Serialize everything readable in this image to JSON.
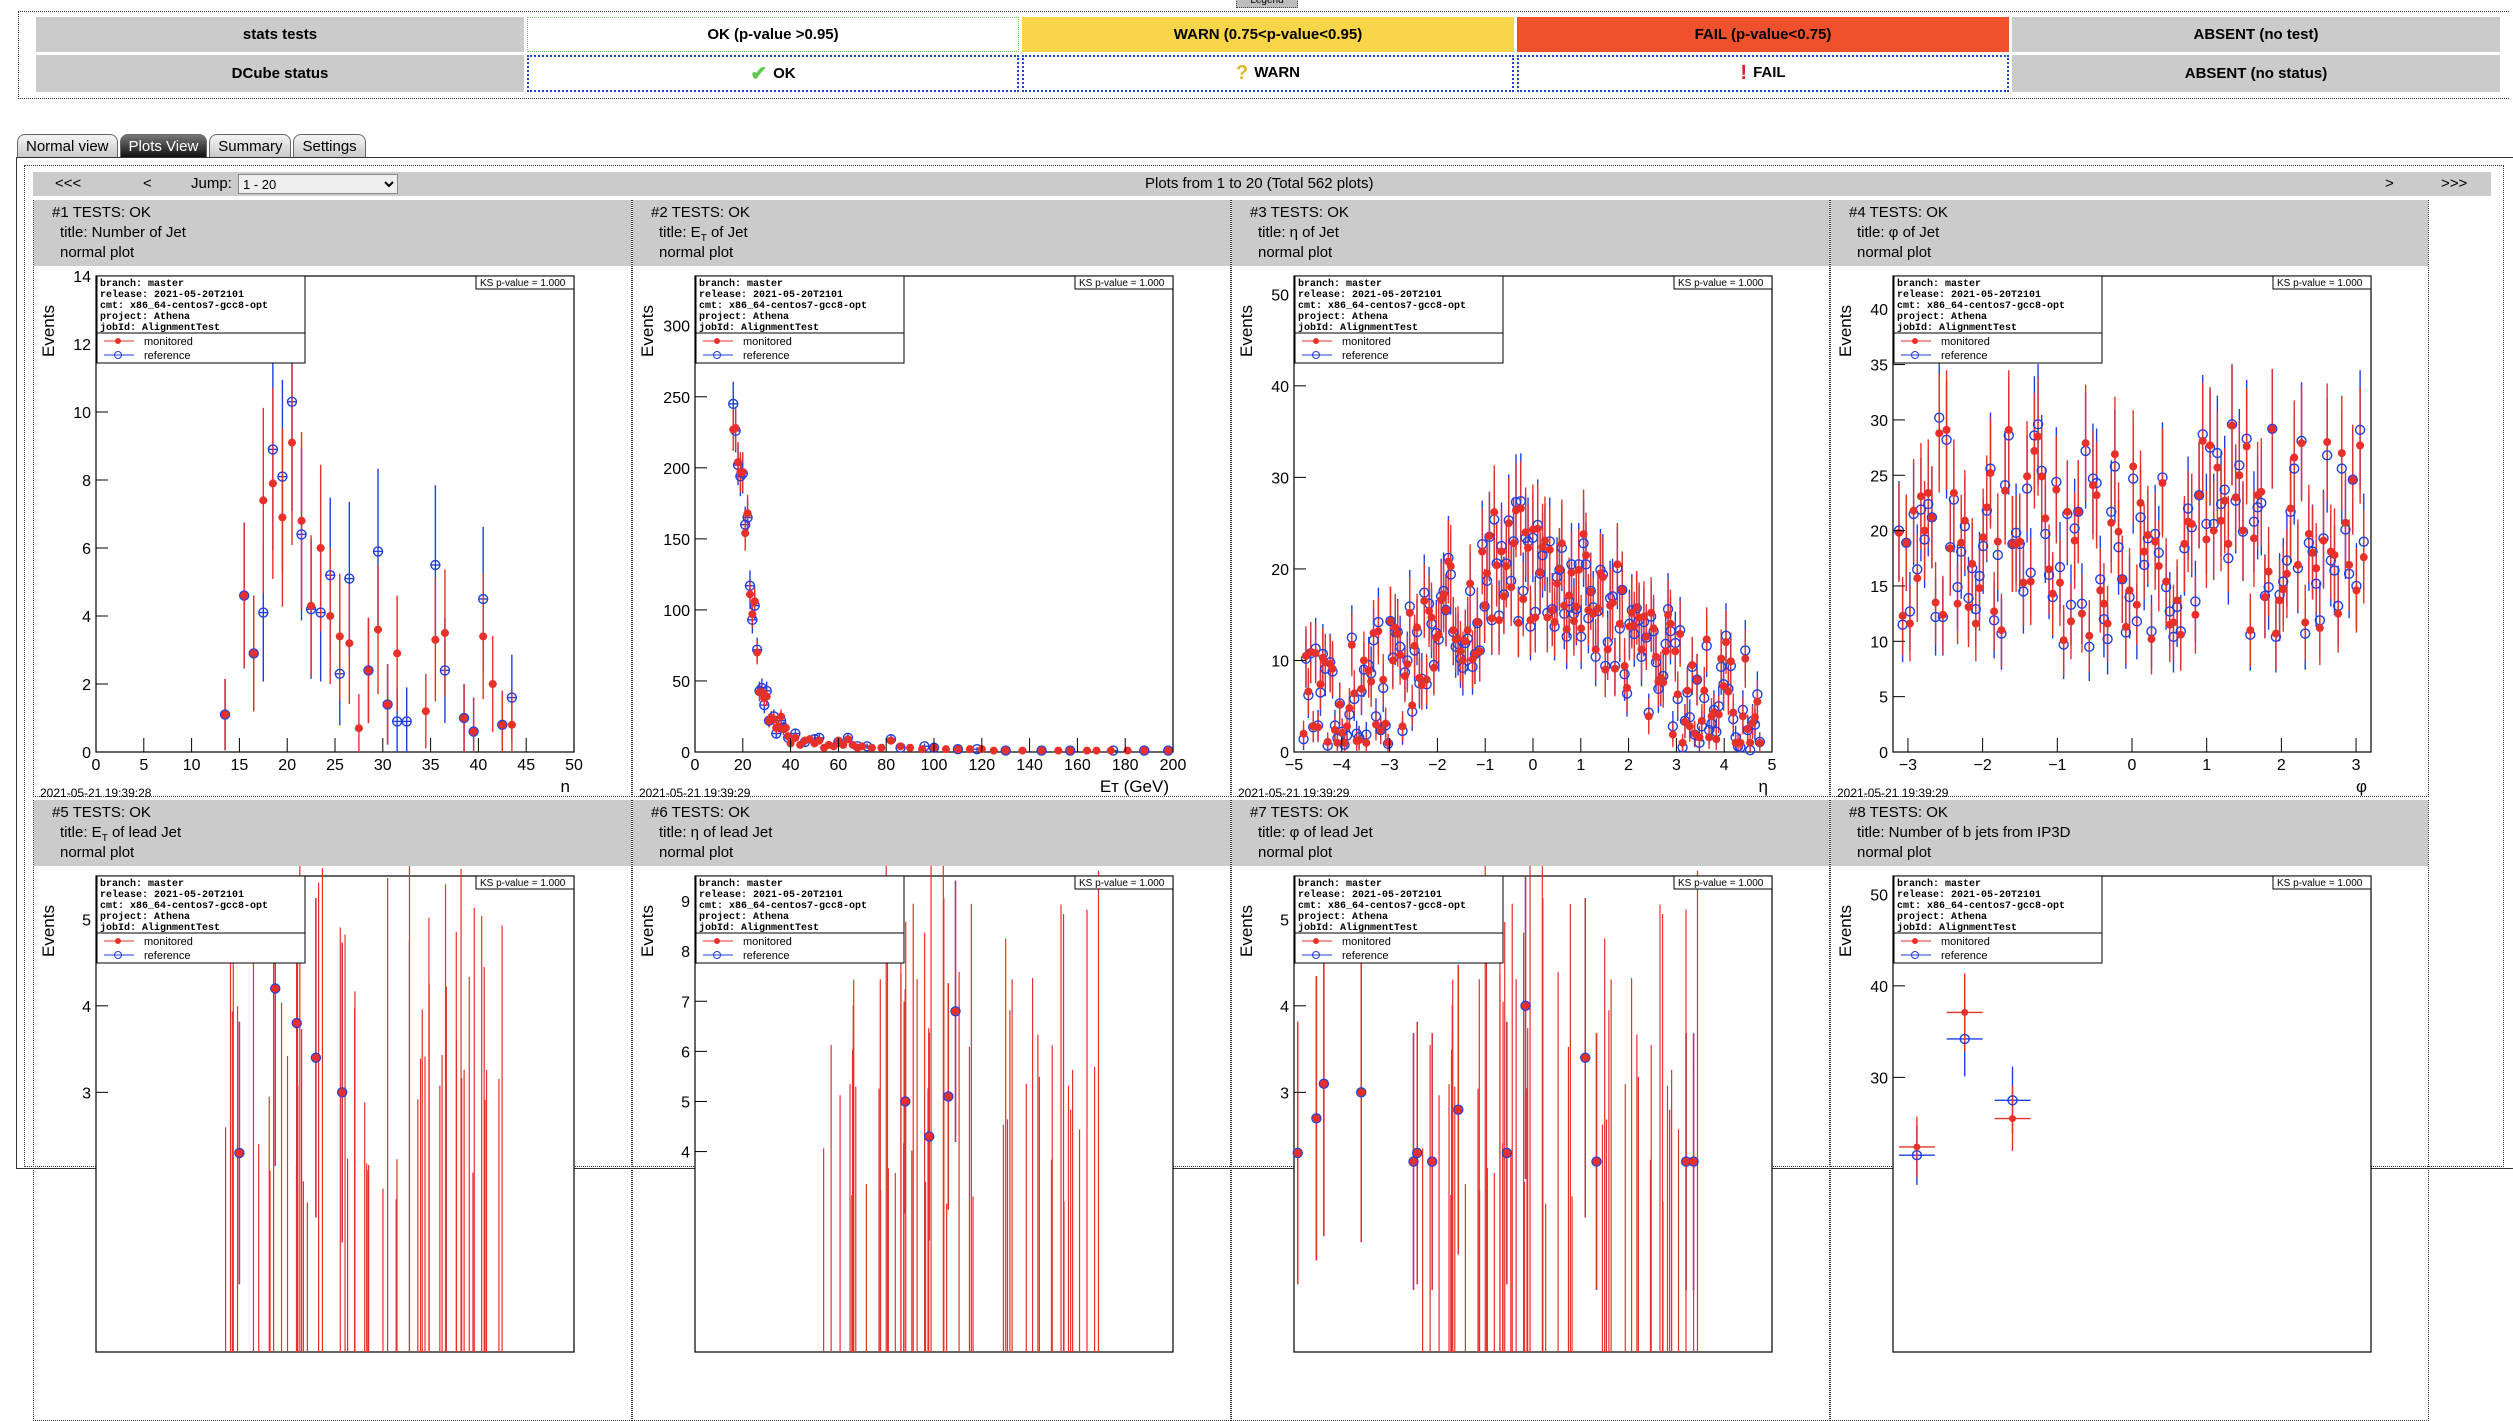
{
  "legend_button": "Legend",
  "legend": {
    "rows": [
      {
        "label": "stats tests",
        "cells": [
          {
            "text": "OK (p-value >0.95)",
            "kind": "ok"
          },
          {
            "text": "WARN (0.75<p-value<0.95)",
            "kind": "warn"
          },
          {
            "text": "FAIL (p-value<0.75)",
            "kind": "fail"
          },
          {
            "text": "ABSENT (no test)",
            "kind": "abs"
          }
        ]
      },
      {
        "label": "DCube status",
        "cells": [
          {
            "text": "OK",
            "kind": "st",
            "icon": "check-icon",
            "glyph": "✔",
            "color": "#5cc94a"
          },
          {
            "text": "WARN",
            "kind": "st",
            "icon": "question-icon",
            "glyph": "?",
            "color": "#e0b62a"
          },
          {
            "text": "FAIL",
            "kind": "st",
            "icon": "exclamation-icon",
            "glyph": "!",
            "color": "#e02020"
          },
          {
            "text": "ABSENT (no status)",
            "kind": "abs"
          }
        ]
      }
    ],
    "colors": {
      "ok_border": "#6ad36a",
      "warn": "#f9d54a",
      "fail": "#ee512b",
      "absent": "#cbcbcb"
    }
  },
  "tabs": [
    {
      "label": "Normal view",
      "active": false
    },
    {
      "label": "Plots View",
      "active": true
    },
    {
      "label": "Summary",
      "active": false
    },
    {
      "label": "Settings",
      "active": false
    }
  ],
  "nav": {
    "first": "<<<",
    "prev": "<",
    "jump_label": "Jump:",
    "jump_value": "1 - 20",
    "range_text": "Plots from 1 to 20 (Total 562 plots)",
    "next": ">",
    "last": ">>>"
  },
  "plot_common": {
    "info": [
      [
        "branch:",
        "master"
      ],
      [
        "release:",
        "2021-05-20T2101"
      ],
      [
        "cmt:",
        "x86_64-centos7-gcc8-opt"
      ],
      [
        "project:",
        "Athena"
      ],
      [
        "jobId:",
        "AlignmentTest"
      ]
    ],
    "legend_monitored": "monitored",
    "legend_reference": "reference",
    "ks_text": "KS   p-value = 1.000",
    "ylabel": "Events",
    "monitored_color": "#e8302a",
    "reference_color": "#1f3fe0"
  },
  "plots": [
    {
      "header": "#1 TESTS: OK",
      "title": "title: Number of Jet",
      "kind": "normal plot",
      "timestamp": "2021-05-21 19:39:28",
      "chart_data": {
        "type": "scatter",
        "xlabel": "n",
        "xlim": [
          0,
          50
        ],
        "ylim": [
          0,
          14
        ],
        "xticks": [
          0,
          5,
          10,
          15,
          20,
          25,
          30,
          35,
          40,
          45,
          50
        ],
        "yticks": [
          0,
          2,
          4,
          6,
          8,
          10,
          12,
          14
        ],
        "monitored": [
          [
            13.5,
            1.1
          ],
          [
            15.5,
            4.6
          ],
          [
            16.5,
            2.9
          ],
          [
            17.5,
            7.4
          ],
          [
            18.5,
            7.9
          ],
          [
            19.5,
            6.9
          ],
          [
            20.5,
            9.1
          ],
          [
            21.5,
            6.8
          ],
          [
            22.5,
            4.3
          ],
          [
            23.5,
            6.0
          ],
          [
            24.5,
            4.0
          ],
          [
            25.5,
            3.4
          ],
          [
            26.5,
            3.2
          ],
          [
            27.5,
            0.7
          ],
          [
            28.5,
            2.4
          ],
          [
            29.5,
            3.6
          ],
          [
            30.5,
            1.4
          ],
          [
            31.5,
            2.9
          ],
          [
            34.5,
            1.2
          ],
          [
            35.5,
            3.3
          ],
          [
            36.5,
            3.5
          ],
          [
            38.5,
            1.0
          ],
          [
            39.5,
            0.6
          ],
          [
            40.5,
            3.4
          ],
          [
            41.5,
            2.0
          ],
          [
            42.5,
            0.8
          ],
          [
            43.5,
            0.8
          ]
        ],
        "reference": [
          [
            13.5,
            1.1
          ],
          [
            15.5,
            4.6
          ],
          [
            16.5,
            2.9
          ],
          [
            17.5,
            4.1
          ],
          [
            18.5,
            8.9
          ],
          [
            19.5,
            8.1
          ],
          [
            20.5,
            10.3
          ],
          [
            21.5,
            6.4
          ],
          [
            22.5,
            4.2
          ],
          [
            23.5,
            4.1
          ],
          [
            24.5,
            5.2
          ],
          [
            25.5,
            2.3
          ],
          [
            26.5,
            5.1
          ],
          [
            28.5,
            2.4
          ],
          [
            29.5,
            5.9
          ],
          [
            30.5,
            1.4
          ],
          [
            31.5,
            0.9
          ],
          [
            32.5,
            0.9
          ],
          [
            35.5,
            5.5
          ],
          [
            36.5,
            2.4
          ],
          [
            38.5,
            1.0
          ],
          [
            39.5,
            0.6
          ],
          [
            40.5,
            4.5
          ],
          [
            42.5,
            0.8
          ],
          [
            43.5,
            1.6
          ]
        ]
      }
    },
    {
      "header": "#2 TESTS: OK",
      "title": "title: E_T of Jet",
      "kind": "normal plot",
      "timestamp": "2021-05-21 19:39:29",
      "chart_data": {
        "type": "scatter",
        "xlabel": "E_T (GeV)",
        "xlim": [
          0,
          200
        ],
        "ylim": [
          0,
          335
        ],
        "xticks": [
          0,
          20,
          40,
          60,
          80,
          100,
          120,
          140,
          160,
          180,
          200
        ],
        "yticks": [
          0,
          50,
          100,
          150,
          200,
          250,
          300
        ],
        "monitored": [
          [
            16,
            227
          ],
          [
            17,
            228
          ],
          [
            18,
            204
          ],
          [
            19,
            197
          ],
          [
            20,
            197
          ],
          [
            21,
            154
          ],
          [
            22,
            168
          ],
          [
            23,
            111
          ],
          [
            24,
            97
          ],
          [
            25,
            106
          ],
          [
            26,
            70
          ],
          [
            27,
            42
          ],
          [
            28,
            42
          ],
          [
            29,
            38
          ],
          [
            30,
            39
          ],
          [
            31,
            22
          ],
          [
            32,
            24
          ],
          [
            33,
            23
          ],
          [
            34,
            17
          ],
          [
            35,
            18
          ],
          [
            36,
            25
          ],
          [
            37,
            16
          ],
          [
            38,
            17
          ],
          [
            39,
            11
          ],
          [
            40,
            6
          ],
          [
            42,
            10
          ],
          [
            44,
            5
          ],
          [
            46,
            8
          ],
          [
            48,
            9
          ],
          [
            50,
            6
          ],
          [
            52,
            8
          ],
          [
            54,
            3
          ],
          [
            56,
            5
          ],
          [
            58,
            4
          ],
          [
            60,
            8
          ],
          [
            62,
            5
          ],
          [
            64,
            9
          ],
          [
            66,
            5
          ],
          [
            68,
            3
          ],
          [
            70,
            4
          ],
          [
            74,
            3
          ],
          [
            78,
            3
          ],
          [
            82,
            8
          ],
          [
            86,
            4
          ],
          [
            90,
            3
          ],
          [
            95,
            2
          ],
          [
            100,
            3
          ],
          [
            105,
            2
          ],
          [
            110,
            2
          ],
          [
            115,
            2
          ],
          [
            120,
            2
          ],
          [
            125,
            1
          ],
          [
            130,
            1
          ],
          [
            137,
            1
          ],
          [
            145,
            1
          ],
          [
            152,
            1
          ],
          [
            157,
            1
          ],
          [
            164,
            1
          ],
          [
            168,
            1
          ],
          [
            174,
            1
          ],
          [
            181,
            1
          ],
          [
            188,
            1
          ],
          [
            198,
            1
          ]
        ],
        "reference": [
          [
            16,
            245
          ],
          [
            17,
            226
          ],
          [
            18,
            202
          ],
          [
            19,
            194
          ],
          [
            20,
            196
          ],
          [
            21,
            160
          ],
          [
            22,
            165
          ],
          [
            23,
            117
          ],
          [
            24,
            93
          ],
          [
            25,
            103
          ],
          [
            26,
            72
          ],
          [
            27,
            43
          ],
          [
            28,
            45
          ],
          [
            29,
            33
          ],
          [
            30,
            43
          ],
          [
            31,
            22
          ],
          [
            33,
            25
          ],
          [
            34,
            13
          ],
          [
            36,
            22
          ],
          [
            37,
            17
          ],
          [
            39,
            10
          ],
          [
            42,
            13
          ],
          [
            46,
            7
          ],
          [
            50,
            9
          ],
          [
            52,
            10
          ],
          [
            60,
            7
          ],
          [
            64,
            10
          ],
          [
            68,
            4
          ],
          [
            72,
            4
          ],
          [
            82,
            9
          ],
          [
            86,
            3
          ],
          [
            96,
            4
          ],
          [
            100,
            3
          ],
          [
            110,
            2
          ],
          [
            118,
            2
          ],
          [
            130,
            1
          ],
          [
            145,
            1
          ],
          [
            157,
            1
          ],
          [
            175,
            1
          ],
          [
            188,
            1
          ],
          [
            198,
            1
          ]
        ]
      }
    },
    {
      "header": "#3 TESTS: OK",
      "title": "title: η of Jet",
      "kind": "normal plot",
      "timestamp": "2021-05-21 19:39:29",
      "chart_data": {
        "type": "scatter",
        "xlabel": "η",
        "xlim": [
          -5,
          5
        ],
        "ylim": [
          0,
          52
        ],
        "xticks": [
          -5,
          -4,
          -3,
          -2,
          -1,
          0,
          1,
          2,
          3,
          4,
          5
        ],
        "yticks": [
          0,
          10,
          20,
          30,
          40,
          50
        ],
        "generator": "eta",
        "seed": 3
      }
    },
    {
      "header": "#4 TESTS: OK",
      "title": "title: φ of Jet",
      "kind": "normal plot",
      "timestamp": "2021-05-21 19:39:29",
      "chart_data": {
        "type": "scatter",
        "xlabel": "φ",
        "xlim": [
          -3.2,
          3.2
        ],
        "ylim": [
          0,
          43
        ],
        "xticks": [
          -3,
          -2,
          -1,
          0,
          1,
          2,
          3
        ],
        "yticks": [
          0,
          5,
          10,
          15,
          20,
          25,
          30,
          35,
          40
        ],
        "generator": "phi",
        "seed": 7
      }
    },
    {
      "header": "#5 TESTS: OK",
      "title": "title: E_T of lead Jet",
      "kind": "normal plot",
      "timestamp": "",
      "chart_data": {
        "type": "scatter",
        "xlabel": "",
        "xlim": [
          0,
          200
        ],
        "ylim": [
          0,
          5.5
        ],
        "yticks": [
          3,
          4,
          5
        ],
        "monitored": [
          [
            60,
            2.3
          ],
          [
            75,
            4.2
          ],
          [
            84,
            3.8
          ],
          [
            92,
            3.4
          ],
          [
            103,
            3.0
          ]
        ],
        "reference": [
          [
            60,
            2.3
          ],
          [
            75,
            4.2
          ],
          [
            84,
            3.8
          ],
          [
            92,
            3.4
          ],
          [
            103,
            3.0
          ]
        ],
        "spikes": "lead_et"
      }
    },
    {
      "header": "#6 TESTS: OK",
      "title": "title: η of lead Jet",
      "kind": "normal plot",
      "timestamp": "",
      "chart_data": {
        "type": "scatter",
        "xlabel": "",
        "xlim": [
          -5,
          5
        ],
        "ylim": [
          0,
          9.5
        ],
        "yticks": [
          4,
          5,
          6,
          7,
          8,
          9
        ],
        "monitored": [
          [
            -0.6,
            5.0
          ],
          [
            -0.1,
            4.3
          ],
          [
            0.3,
            5.1
          ],
          [
            0.45,
            6.8
          ]
        ],
        "reference": [
          [
            -0.6,
            5.0
          ],
          [
            -0.1,
            4.3
          ],
          [
            0.3,
            5.1
          ],
          [
            0.45,
            6.8
          ]
        ],
        "spikes": "lead_eta"
      }
    },
    {
      "header": "#7 TESTS: OK",
      "title": "title: φ of lead Jet",
      "kind": "normal plot",
      "timestamp": "",
      "chart_data": {
        "type": "scatter",
        "xlabel": "",
        "xlim": [
          -3.2,
          3.2
        ],
        "ylim": [
          0,
          5.5
        ],
        "yticks": [
          3,
          4,
          5
        ],
        "monitored": [
          [
            -3.15,
            2.3
          ],
          [
            -2.9,
            2.7
          ],
          [
            -2.8,
            3.1
          ],
          [
            -2.3,
            3.0
          ],
          [
            -1.6,
            2.2
          ],
          [
            -1.55,
            2.3
          ],
          [
            -1.35,
            2.2
          ],
          [
            -1.0,
            2.8
          ],
          [
            -0.35,
            2.3
          ],
          [
            -0.1,
            4.0
          ],
          [
            0.7,
            3.4
          ],
          [
            0.85,
            2.2
          ],
          [
            2.05,
            2.2
          ],
          [
            2.15,
            2.2
          ]
        ],
        "reference": [
          [
            -3.15,
            2.3
          ],
          [
            -2.9,
            2.7
          ],
          [
            -2.8,
            3.1
          ],
          [
            -2.3,
            3.0
          ],
          [
            -1.6,
            2.2
          ],
          [
            -1.55,
            2.3
          ],
          [
            -1.35,
            2.2
          ],
          [
            -1.0,
            2.8
          ],
          [
            -0.35,
            2.3
          ],
          [
            -0.1,
            4.0
          ],
          [
            0.7,
            3.4
          ],
          [
            0.85,
            2.2
          ],
          [
            2.05,
            2.2
          ],
          [
            2.15,
            2.2
          ]
        ],
        "spikes": "lead_phi"
      }
    },
    {
      "header": "#8 TESTS: OK",
      "title": "title: Number of b jets from IP3D",
      "kind": "normal plot",
      "timestamp": "",
      "chart_data": {
        "type": "scatter",
        "xlabel": "",
        "xlim": [
          -0.5,
          9.5
        ],
        "ylim": [
          0,
          52
        ],
        "yticks": [
          30,
          40,
          50
        ],
        "monitored": [
          [
            0,
            22.4
          ],
          [
            1,
            37.1
          ],
          [
            2,
            25.5
          ]
        ],
        "reference": [
          [
            0,
            21.5
          ],
          [
            1,
            34.2
          ],
          [
            2,
            27.5
          ]
        ],
        "wide_bins": true
      }
    }
  ]
}
